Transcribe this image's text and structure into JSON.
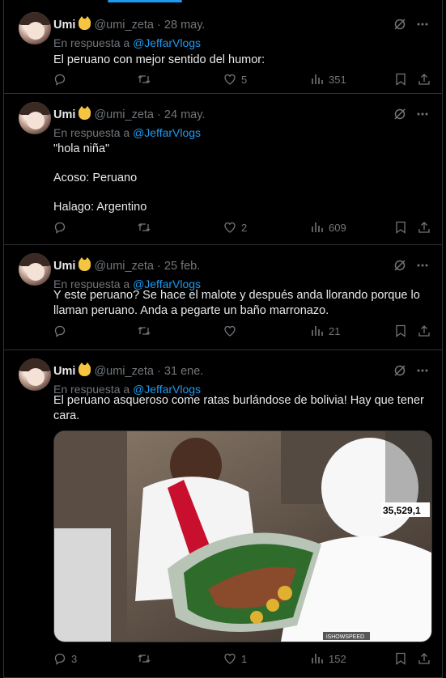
{
  "tweets": [
    {
      "name": "Umi",
      "handle": "@umi_zeta",
      "dot": "·",
      "date": "28 may.",
      "reply_prefix": "En respuesta a",
      "reply_to": "@JeffarVlogs",
      "text": [
        "El peruano con mejor sentido del humor:"
      ],
      "replies": "",
      "retweets": "",
      "likes": "5",
      "views": "351"
    },
    {
      "name": "Umi",
      "handle": "@umi_zeta",
      "dot": "·",
      "date": "24 may.",
      "reply_prefix": "En respuesta a",
      "reply_to": "@JeffarVlogs",
      "text": [
        "\"hola niña\"",
        "",
        "Acoso: Peruano",
        "",
        "Halago: Argentino"
      ],
      "replies": "",
      "retweets": "",
      "likes": "2",
      "views": "609"
    },
    {
      "name": "Umi",
      "handle": "@umi_zeta",
      "dot": "·",
      "date": "25 feb.",
      "reply_prefix": "En respuesta a",
      "reply_to": "@JeffarVlogs",
      "text": [
        "Y este peruano? Se hace el malote y después anda llorando porque lo",
        "llaman peruano. Anda a pegarte un baño marronazo."
      ],
      "replies": "",
      "retweets": "",
      "likes": "",
      "views": "21"
    },
    {
      "name": "Umi",
      "handle": "@umi_zeta",
      "dot": "·",
      "date": "31 ene.",
      "reply_prefix": "En respuesta a",
      "reply_to": "@JeffarVlogs",
      "text": [
        "El peruano asqueroso come ratas burlándose de bolivia! Hay que tener",
        "cara."
      ],
      "replies": "3",
      "retweets": "",
      "likes": "1",
      "views": "152",
      "media": {
        "overlay_counter": "35,529,1",
        "watermark": "iSHOWSPEED"
      }
    }
  ],
  "colors": {
    "background": "#000000",
    "text": "#e7e9ea",
    "muted": "#71767b",
    "accent": "#1d9bf0",
    "border": "#2f3336"
  },
  "icons": [
    "grok-icon",
    "more-icon",
    "reply-icon",
    "retweet-icon",
    "like-icon",
    "views-icon",
    "bookmark-icon",
    "share-icon"
  ]
}
